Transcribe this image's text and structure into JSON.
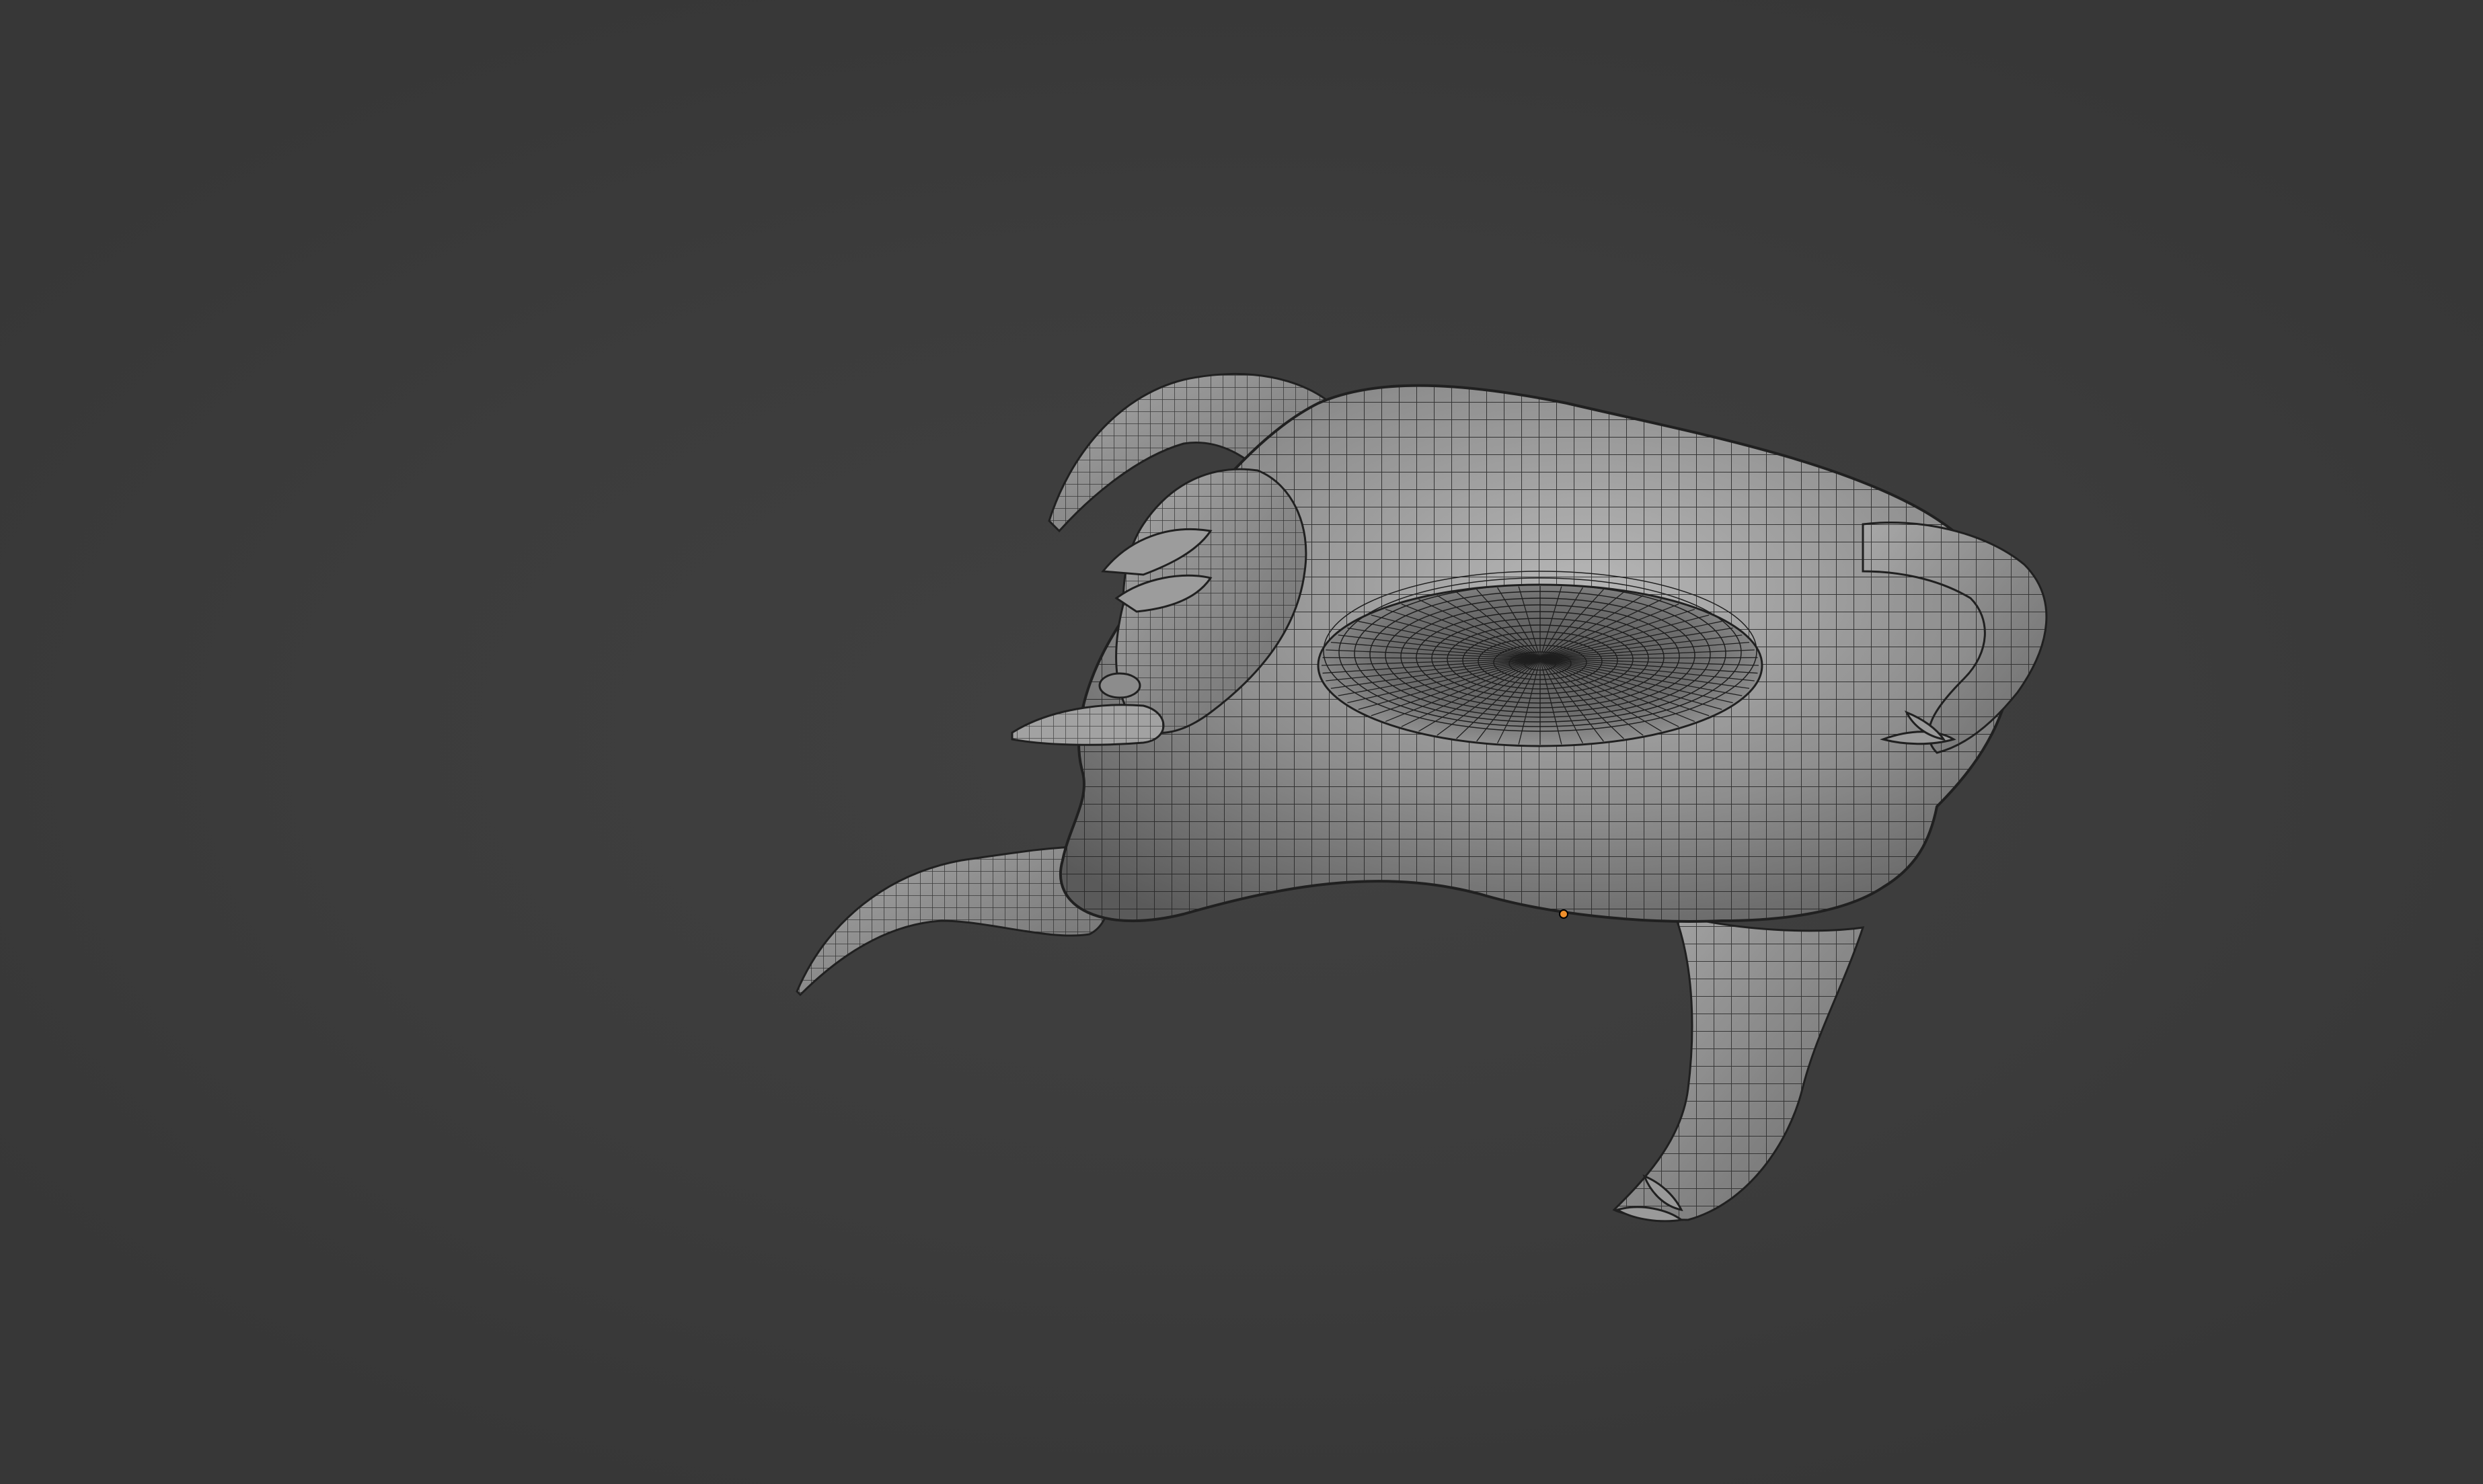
{
  "viewport": {
    "background_color": "#3d3d3d",
    "mesh_fill": "#8a8a8a",
    "mesh_shadow": "#5e5e5e",
    "mesh_highlight": "#b4b4b4",
    "wire_color": "#1c1c1c",
    "origin_color": "#f0902c"
  },
  "scene": {
    "object_icon": "sculpt-mesh-icon",
    "origin_icon": "object-origin-dot-icon"
  }
}
